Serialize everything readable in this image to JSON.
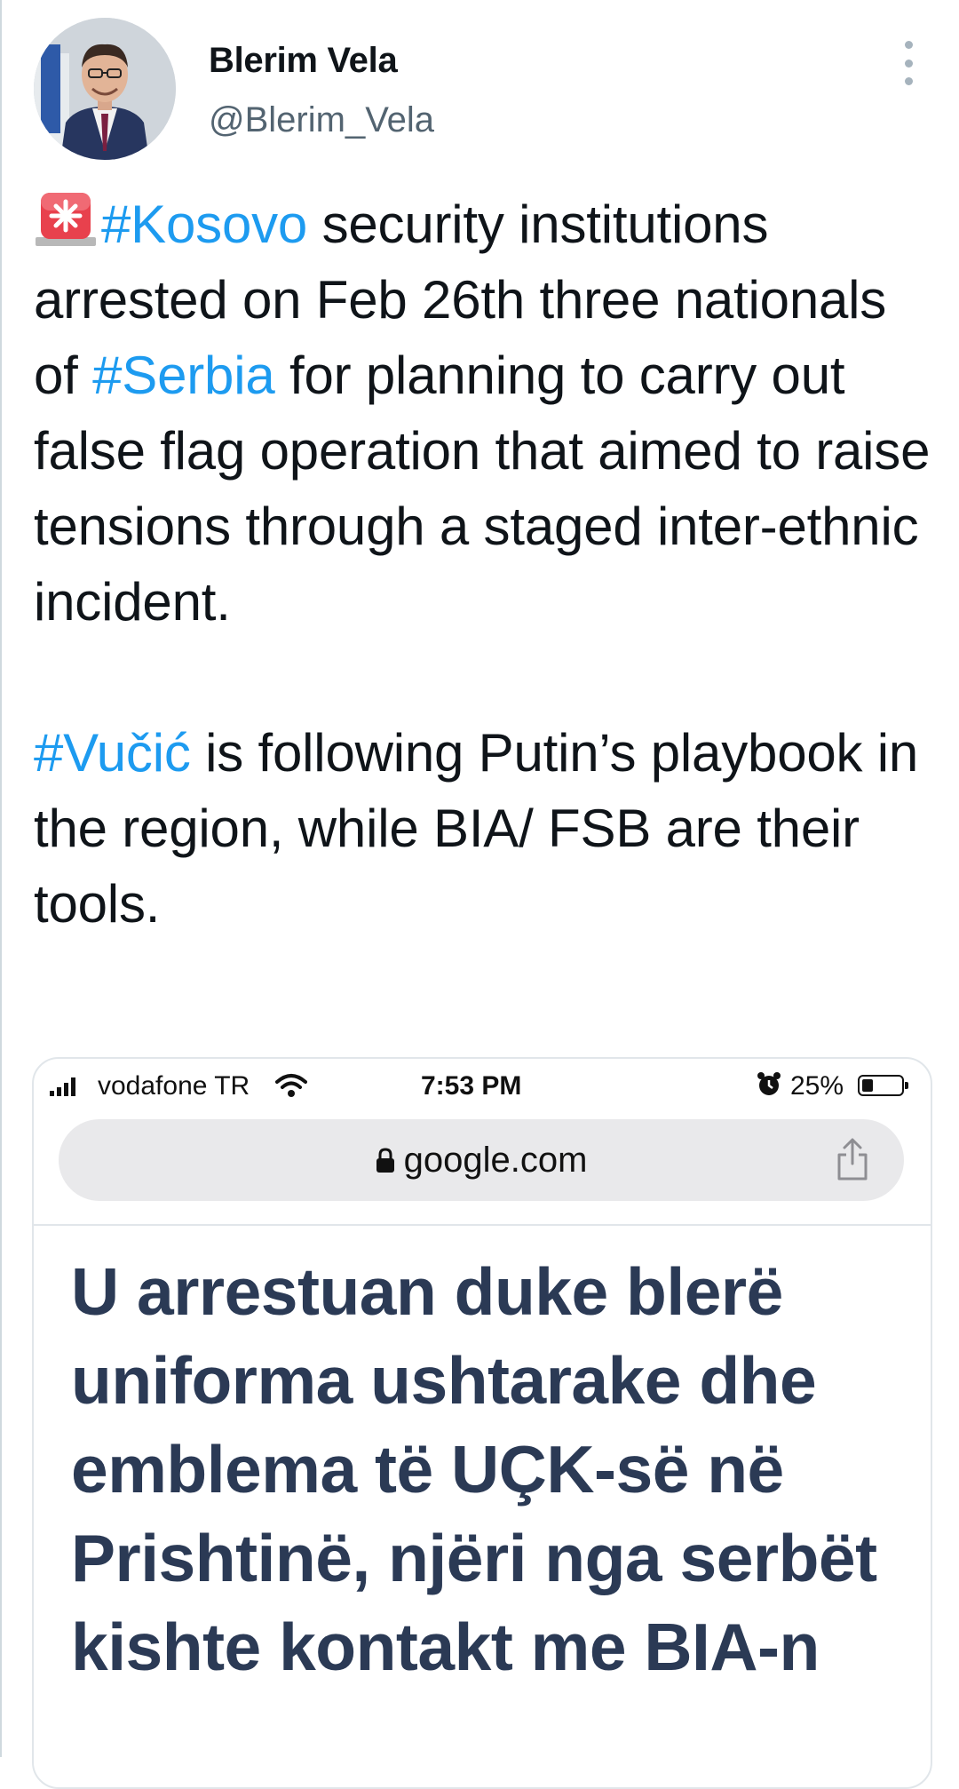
{
  "author": {
    "display_name": "Blerim Vela",
    "handle": "@Blerim_Vela",
    "avatar": "profile-photo"
  },
  "more_icon": "vertical-ellipsis-icon",
  "tweet": {
    "siren_icon": "police-siren-emoji",
    "p1_tag_kosovo": "#Kosovo",
    "p1_text_a": " security institutions arrested on Feb 26th three nationals of ",
    "p1_tag_serbia": "#Serbia",
    "p1_text_b": " for planning to carry out false flag operation that aimed to raise tensions through a staged inter-ethnic incident.",
    "p2_tag_vucic": "#Vučić",
    "p2_text": " is following Putin’s playbook in the region, while BIA/ FSB are their tools.",
    "hashtag_color": "#1d9bf0"
  },
  "embedded_screenshot": {
    "carrier": "vodafone TR",
    "time": "7:53 PM",
    "battery": "25%",
    "battery_level": 0.25,
    "url": "google.com",
    "headline": "U arrestuan duke blerë uniforma ushtarake dhe emblema të UÇK-së në Prishtinë, njëri nga serbët kishte kontakt me BIA-n"
  }
}
